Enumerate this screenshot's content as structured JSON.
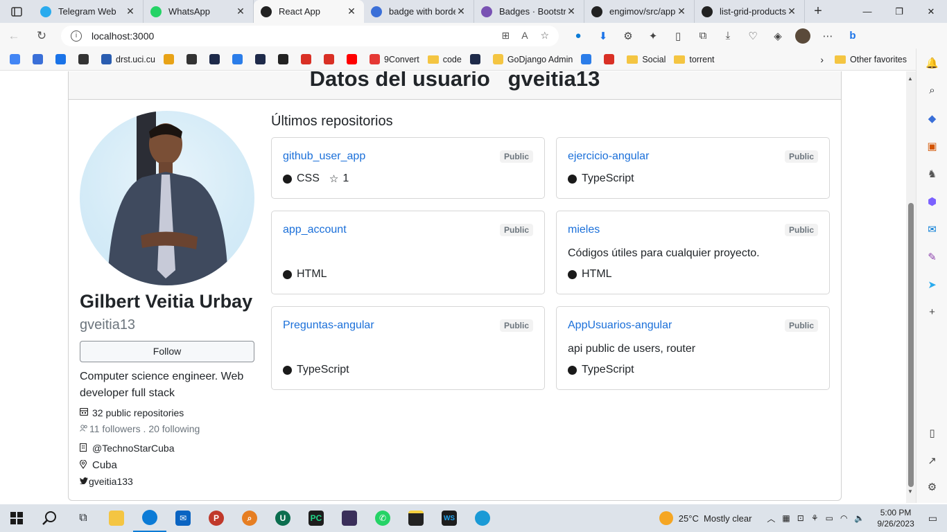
{
  "browser": {
    "tabs": [
      {
        "label": "Telegram Web",
        "color": "#2aabee",
        "icon": "telegram-icon"
      },
      {
        "label": "WhatsApp",
        "color": "#25d366",
        "icon": "whatsapp-icon"
      },
      {
        "label": "React App",
        "color": "#222222",
        "icon": "react-icon",
        "active": true
      },
      {
        "label": "badge with borde",
        "color": "#3a6fd8",
        "icon": "search-icon"
      },
      {
        "label": "Badges · Bootstra",
        "color": "#7952b3",
        "icon": "bootstrap-icon"
      },
      {
        "label": "engimov/src/app",
        "color": "#222222",
        "icon": "github-icon"
      },
      {
        "label": "list-grid-products",
        "color": "#222222",
        "icon": "github-icon"
      }
    ],
    "url": "localhost:3000",
    "bookmarks": [
      {
        "label": "",
        "icon": "google-icon",
        "color": "#4285f4"
      },
      {
        "label": "",
        "icon": "search-icon",
        "color": "#3a6fd8"
      },
      {
        "label": "",
        "icon": "zoho-icon",
        "color": "#1a73e8"
      },
      {
        "label": "",
        "icon": "uci-icon",
        "color": "#333333"
      },
      {
        "label": "drst.uci.cu",
        "icon": "doc-icon",
        "color": "#2a5db0"
      },
      {
        "label": "",
        "icon": "orange-icon",
        "color": "#e8a317"
      },
      {
        "label": "",
        "icon": "fire-icon",
        "color": "#333333"
      },
      {
        "label": "",
        "icon": "app-icon",
        "color": "#1e2a4a"
      },
      {
        "label": "",
        "icon": "hat-icon",
        "color": "#2b7de9"
      },
      {
        "label": "",
        "icon": "uci-icon",
        "color": "#1e2a4a"
      },
      {
        "label": "",
        "icon": "github-icon",
        "color": "#222222"
      },
      {
        "label": "",
        "icon": "gmail-icon",
        "color": "#d93025"
      },
      {
        "label": "",
        "icon": "gmail-icon",
        "color": "#d93025"
      },
      {
        "label": "",
        "icon": "youtube-icon",
        "color": "#ff0000"
      },
      {
        "label": "9Convert",
        "icon": "pin-icon",
        "color": "#e53935"
      },
      {
        "label": "code",
        "icon": "folder-icon",
        "color": "#f4c542"
      },
      {
        "label": "",
        "icon": "app-icon",
        "color": "#1e2a4a"
      },
      {
        "label": "GoDjango Admin",
        "icon": "mail-icon",
        "color": "#f4c542"
      },
      {
        "label": "",
        "icon": "hat-icon",
        "color": "#2b7de9"
      },
      {
        "label": "",
        "icon": "m-icon",
        "color": "#d93025"
      },
      {
        "label": "Social",
        "icon": "folder-icon",
        "color": "#f4c542"
      },
      {
        "label": "torrent",
        "icon": "folder-icon",
        "color": "#f4c542"
      }
    ],
    "other_favorites": "Other favorites"
  },
  "page": {
    "header_title": "Datos del usuario   gveitia13",
    "profile": {
      "name": "Gilbert Veitia Urbay",
      "login": "gveitia13",
      "follow_label": "Follow",
      "bio": "Computer science engineer. Web developer full stack",
      "public_repos": "32 public repositories",
      "followers": "11 followers . 20 following",
      "company": "@TechnoStarCuba",
      "location": "Cuba",
      "twitter": "gveitia133"
    },
    "repos_title": "Últimos repositorios",
    "repos": [
      {
        "name": "github_user_app",
        "visibility": "Public",
        "description": "",
        "language": "CSS",
        "stars": "1"
      },
      {
        "name": "ejercicio-angular",
        "visibility": "Public",
        "description": "",
        "language": "TypeScript",
        "stars": ""
      },
      {
        "name": "app_account",
        "visibility": "Public",
        "description": "",
        "language": "HTML",
        "stars": ""
      },
      {
        "name": "mieles",
        "visibility": "Public",
        "description": "Códigos útiles para cualquier proyecto.",
        "language": "HTML",
        "stars": ""
      },
      {
        "name": "Preguntas-angular",
        "visibility": "Public",
        "description": "",
        "language": "TypeScript",
        "stars": ""
      },
      {
        "name": "AppUsuarios-angular",
        "visibility": "Public",
        "description": "api public de users, router",
        "language": "TypeScript",
        "stars": ""
      }
    ]
  },
  "taskbar": {
    "weather": "25°C  Mostly clear",
    "time": "5:00 PM",
    "date": "9/26/2023"
  }
}
